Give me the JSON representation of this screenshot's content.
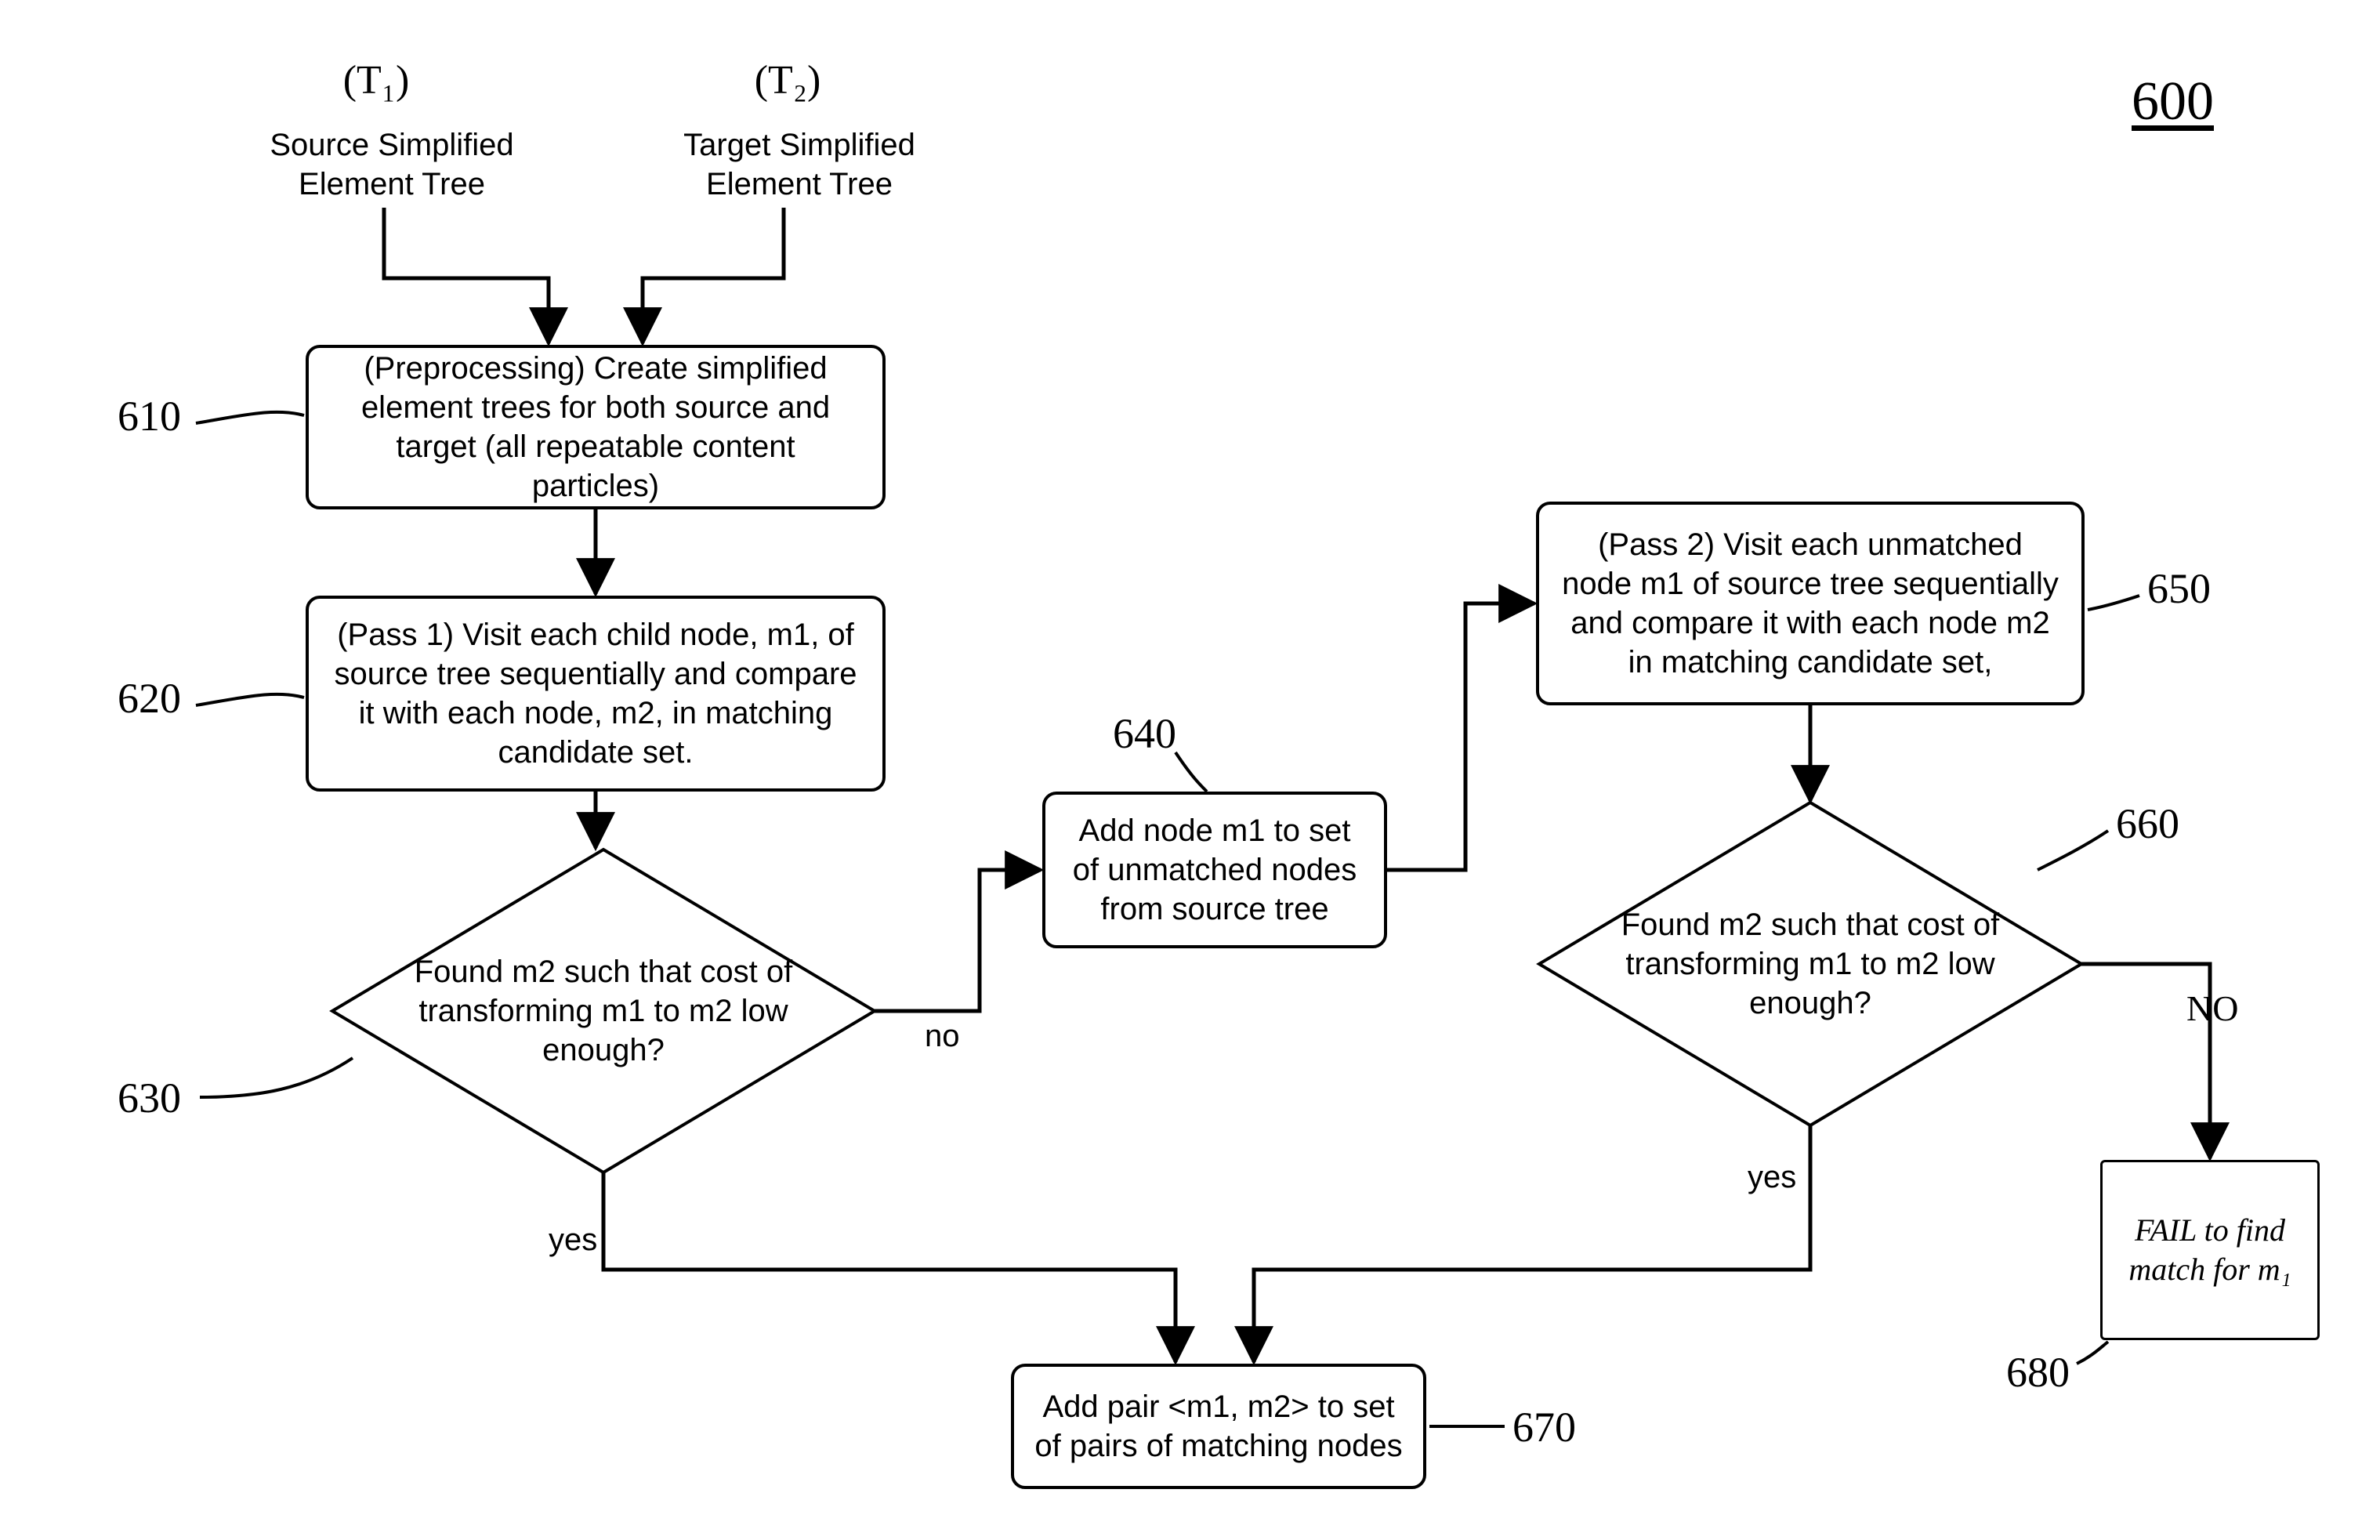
{
  "figure_ref": "600",
  "inputs": {
    "t1_symbol": "(T₁)",
    "t1_label": "Source Simplified Element Tree",
    "t2_symbol": "(T₂)",
    "t2_label": "Target Simplified Element Tree"
  },
  "nodes": {
    "n610": "(Preprocessing) Create simplified element trees for both source and target (all repeatable content particles)",
    "n620": "(Pass 1) Visit each child node, m1, of source tree sequentially and compare it with each node, m2, in matching candidate set.",
    "n630": "Found m2 such that cost of transforming m1 to m2 low enough?",
    "n640": "Add node m1 to set of unmatched nodes from source tree",
    "n650": "(Pass 2) Visit each unmatched node m1 of source tree sequentially and compare it with each node m2 in matching candidate set,",
    "n660": "Found m2 such that cost of transforming m1 to m2 low enough?",
    "n670": "Add pair <m1, m2> to set of pairs of matching nodes",
    "n680": "FAIL to find match for m₁"
  },
  "refs": {
    "r610": "610",
    "r620": "620",
    "r630": "630",
    "r640": "640",
    "r650": "650",
    "r660": "660",
    "r670": "670",
    "r680": "680"
  },
  "edges": {
    "yes": "yes",
    "no": "no",
    "NO": "NO"
  },
  "chart_data": {
    "type": "flowchart",
    "nodes": [
      {
        "id": "T1",
        "kind": "input",
        "label": "(T₁) Source Simplified Element Tree"
      },
      {
        "id": "T2",
        "kind": "input",
        "label": "(T₂) Target Simplified Element Tree"
      },
      {
        "id": "610",
        "kind": "process",
        "label": "(Preprocessing) Create simplified element trees for both source and target (all repeatable content particles)"
      },
      {
        "id": "620",
        "kind": "process",
        "label": "(Pass 1) Visit each child node, m1, of source tree sequentially and compare it with each node, m2, in matching candidate set."
      },
      {
        "id": "630",
        "kind": "decision",
        "label": "Found m2 such that cost of transforming m1 to m2 low enough?"
      },
      {
        "id": "640",
        "kind": "process",
        "label": "Add node m1 to set of unmatched nodes from source tree"
      },
      {
        "id": "650",
        "kind": "process",
        "label": "(Pass 2) Visit each unmatched node m1 of source tree sequentially and compare it with each node m2 in matching candidate set,"
      },
      {
        "id": "660",
        "kind": "decision",
        "label": "Found m2 such that cost of transforming m1 to m2 low enough?"
      },
      {
        "id": "670",
        "kind": "process",
        "label": "Add pair <m1, m2> to set of pairs of matching nodes"
      },
      {
        "id": "680",
        "kind": "terminal",
        "label": "FAIL to find match for m₁"
      }
    ],
    "edges": [
      {
        "from": "T1",
        "to": "610",
        "label": ""
      },
      {
        "from": "T2",
        "to": "610",
        "label": ""
      },
      {
        "from": "610",
        "to": "620",
        "label": ""
      },
      {
        "from": "620",
        "to": "630",
        "label": ""
      },
      {
        "from": "630",
        "to": "640",
        "label": "no"
      },
      {
        "from": "630",
        "to": "670",
        "label": "yes"
      },
      {
        "from": "640",
        "to": "650",
        "label": ""
      },
      {
        "from": "650",
        "to": "660",
        "label": ""
      },
      {
        "from": "660",
        "to": "670",
        "label": "yes"
      },
      {
        "from": "660",
        "to": "680",
        "label": "NO"
      }
    ]
  }
}
